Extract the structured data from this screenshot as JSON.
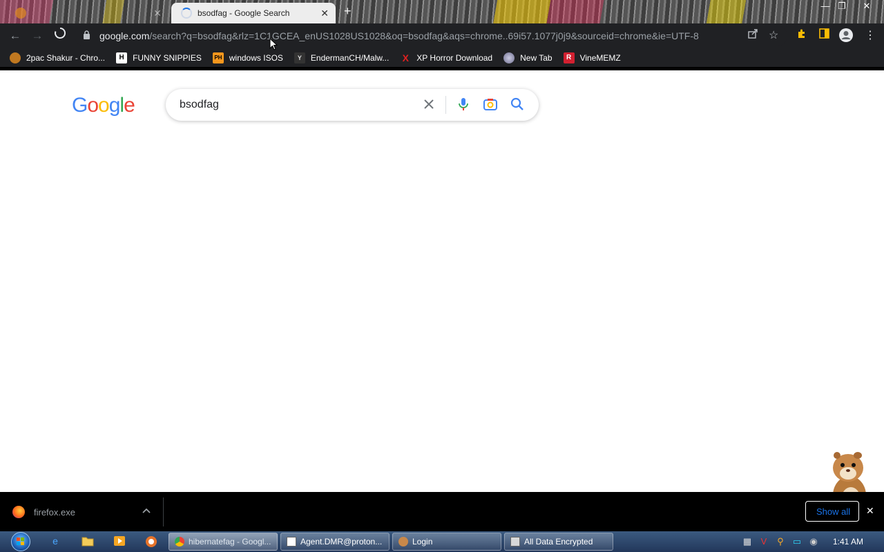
{
  "tabs": [
    {
      "title": "",
      "active": false
    },
    {
      "title": "bsodfag - Google Search",
      "active": true
    }
  ],
  "window_controls": {
    "minimize": "—",
    "maximize": "❐",
    "close": "✕"
  },
  "toolbar": {
    "url_host": "google.com",
    "url_path": "/search?q=bsodfag&rlz=1C1GCEA_enUS1028US1028&oq=bsodfag&aqs=chrome..69i57.1077j0j9&sourceid=chrome&ie=UTF-8"
  },
  "bookmarks": [
    {
      "label": "2pac Shakur - Chro...",
      "icon": "tupac-icon",
      "color": "#e0a030"
    },
    {
      "label": "FUNNY SNIPPIES",
      "icon": "H",
      "color": "#ffffff"
    },
    {
      "label": "windows ISOS",
      "icon": "PH",
      "color": "#f7971d"
    },
    {
      "label": "EndermanCH/Malw...",
      "icon": "Y",
      "color": "#333333"
    },
    {
      "label": "XP Horror Download",
      "icon": "X",
      "color": "#e02020"
    },
    {
      "label": "New Tab",
      "icon": "globe-icon",
      "color": "#a0a0c8"
    },
    {
      "label": "VineMEMZ",
      "icon": "R",
      "color": "#d22030"
    }
  ],
  "google": {
    "logo_letters": [
      {
        "ch": "G",
        "color": "#4285F4"
      },
      {
        "ch": "o",
        "color": "#EA4335"
      },
      {
        "ch": "o",
        "color": "#FBBC05"
      },
      {
        "ch": "g",
        "color": "#4285F4"
      },
      {
        "ch": "l",
        "color": "#34A853"
      },
      {
        "ch": "e",
        "color": "#EA4335"
      }
    ],
    "query": "bsodfag"
  },
  "download_shelf": {
    "file": "firefox.exe",
    "show_all": "Show all"
  },
  "taskbar": {
    "tasks": [
      {
        "label": "hibernatefag - Googl...",
        "active": true
      },
      {
        "label": "Agent.DMR@proton...",
        "active": false
      },
      {
        "label": "Login",
        "active": false
      },
      {
        "label": "All Data Encrypted",
        "active": false
      }
    ],
    "clock": "1:41 AM"
  }
}
